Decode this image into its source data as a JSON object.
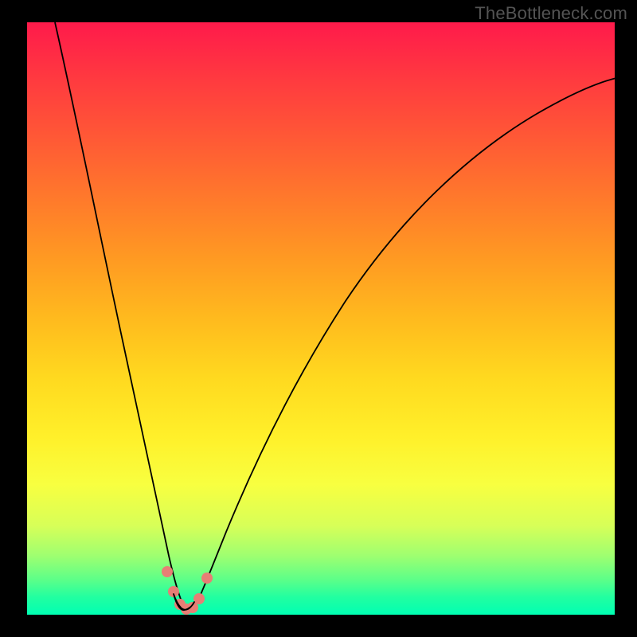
{
  "watermark": "TheBottleneck.com",
  "colors": {
    "background": "#000000",
    "curve": "#000000",
    "marker": "#e77e75",
    "gradient_top": "#ff1a4b",
    "gradient_bottom": "#00ffb3"
  },
  "chart_data": {
    "type": "line",
    "title": "",
    "xlabel": "",
    "ylabel": "",
    "y_meaning": "bottleneck percentage (0 at valley/green, 100 at top/red)",
    "x_meaning": "relative component balance (normalized 0–100)",
    "xlim": [
      0,
      100
    ],
    "ylim": [
      0,
      100
    ],
    "valley_x": 27,
    "series": [
      {
        "name": "bottleneck-curve",
        "x": [
          5,
          10,
          15,
          20,
          23,
          25,
          26,
          27,
          28,
          29,
          31,
          35,
          40,
          50,
          60,
          70,
          80,
          90,
          100
        ],
        "y": [
          100,
          78,
          56,
          32,
          14,
          5,
          2,
          0,
          1,
          3,
          9,
          22,
          35,
          55,
          68,
          77,
          83,
          87,
          90
        ]
      }
    ],
    "markers": {
      "name": "near-valley-points",
      "x": [
        23.5,
        25,
        26,
        27,
        28,
        29,
        30.5
      ],
      "y": [
        7,
        3,
        1,
        0,
        0.5,
        2,
        6
      ]
    },
    "gradient_stops": [
      {
        "pos": 0.0,
        "color": "#ff1a4b"
      },
      {
        "pos": 0.5,
        "color": "#ffba1e"
      },
      {
        "pos": 0.78,
        "color": "#f8ff40"
      },
      {
        "pos": 1.0,
        "color": "#00ffb3"
      }
    ]
  }
}
